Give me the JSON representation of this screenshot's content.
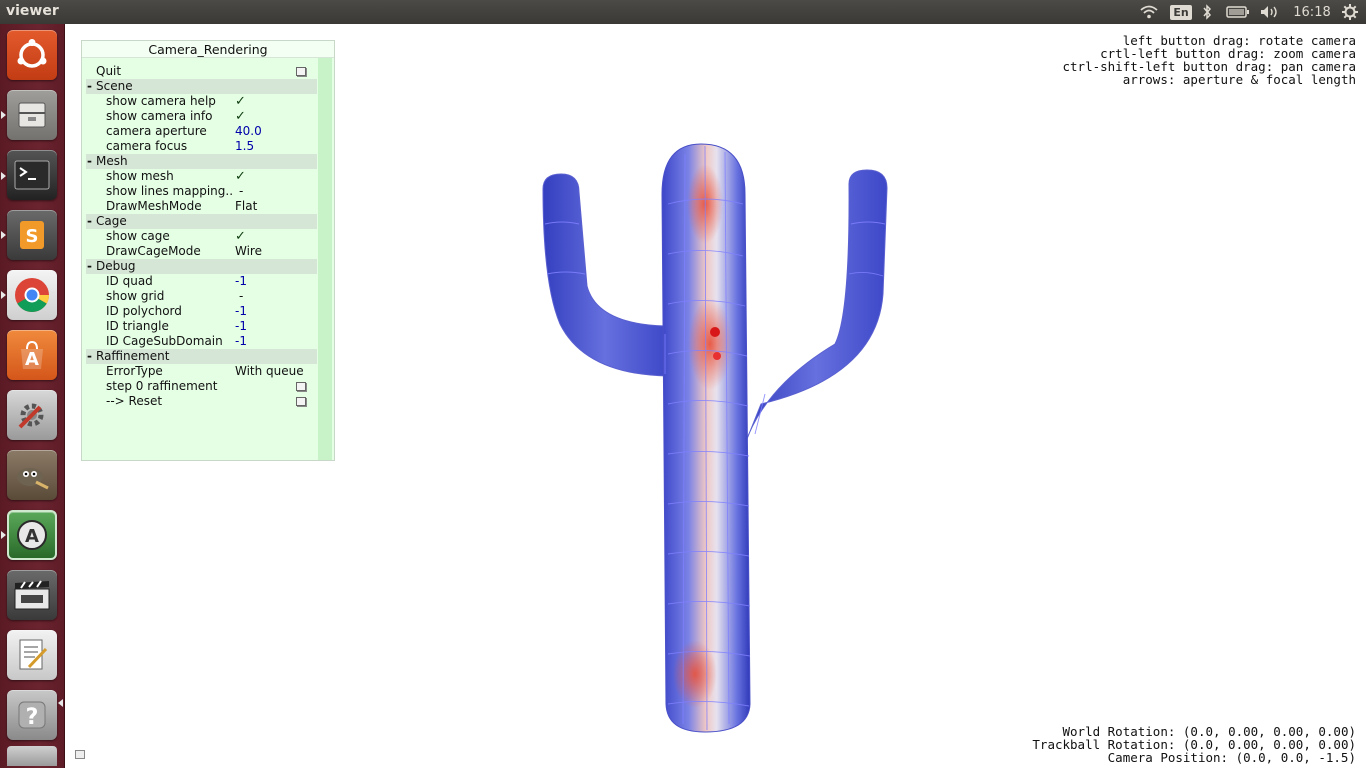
{
  "topbar": {
    "app_title": "viewer",
    "lang": "En",
    "clock": "16:18"
  },
  "icons": {
    "wifi": "wifi-icon",
    "bluetooth": "bluetooth-icon",
    "battery": "battery-icon",
    "volume": "volume-icon",
    "power": "gear-icon"
  },
  "launcher": [
    {
      "name": "ubuntu-dash",
      "color": "#d9461c"
    },
    {
      "name": "files",
      "color": "#8c8a86"
    },
    {
      "name": "terminal",
      "color": "#2c2c2c"
    },
    {
      "name": "sublime-text",
      "color": "#5d5d5d"
    },
    {
      "name": "chrome",
      "color": "#e7e7e7"
    },
    {
      "name": "software-center",
      "color": "#e8752c"
    },
    {
      "name": "system-settings",
      "color": "#c4c4c4"
    },
    {
      "name": "gimp",
      "color": "#7a6a55"
    },
    {
      "name": "software-updater",
      "color": "#3a8a3a"
    },
    {
      "name": "video-editor",
      "color": "#555555"
    },
    {
      "name": "text-editor",
      "color": "#d9d9d9"
    },
    {
      "name": "help",
      "color": "#a0a0a0"
    }
  ],
  "panel": {
    "title": "Camera_Rendering",
    "quit": "Quit",
    "groups": {
      "scene": "Scene",
      "mesh": "Mesh",
      "cage": "Cage",
      "debug": "Debug",
      "raffinement": "Raffinement"
    },
    "rows": {
      "show_camera_help": {
        "label": "show camera help",
        "value": "✓"
      },
      "show_camera_info": {
        "label": "show camera info",
        "value": "✓"
      },
      "camera_aperture": {
        "label": "camera aperture",
        "value": "40.0"
      },
      "camera_focus": {
        "label": "camera focus",
        "value": "1.5"
      },
      "show_mesh": {
        "label": "show mesh",
        "value": "✓"
      },
      "show_lines_mapping": {
        "label": "show lines mapping..",
        "value": "-"
      },
      "draw_mesh_mode": {
        "label": "DrawMeshMode",
        "value": "Flat"
      },
      "show_cage": {
        "label": "show cage",
        "value": "✓"
      },
      "draw_cage_mode": {
        "label": "DrawCageMode",
        "value": "Wire"
      },
      "id_quad": {
        "label": "ID quad",
        "value": "-1"
      },
      "show_grid": {
        "label": "show grid",
        "value": "-"
      },
      "id_polychord": {
        "label": "ID polychord",
        "value": "-1"
      },
      "id_triangle": {
        "label": "ID triangle",
        "value": "-1"
      },
      "id_cagesubdomain": {
        "label": "ID CageSubDomain",
        "value": "-1"
      },
      "error_type": {
        "label": "ErrorType",
        "value": "With queue"
      },
      "step_raffinement": {
        "label": "step 0 raffinement"
      },
      "reset": {
        "label": "--> Reset"
      }
    }
  },
  "help": {
    "line1": "left button drag: rotate camera",
    "line2": "crtl-left button drag: zoom camera",
    "line3": "ctrl-shift-left button drag: pan camera",
    "line4": "arrows: aperture & focal length"
  },
  "info": {
    "world_rotation": "World Rotation: (0.0, 0.00, 0.00, 0.00)",
    "trackball_rotation": "Trackball Rotation: (0.0, 0.00, 0.00, 0.00)",
    "camera_position": "Camera Position: (0.0, 0.0, -1.5)"
  },
  "colors": {
    "mesh_blue": "#4a55d8",
    "mesh_red": "#e0503c",
    "cage_wire": "#7878ff",
    "panel_bg": "#e5ffe5"
  }
}
